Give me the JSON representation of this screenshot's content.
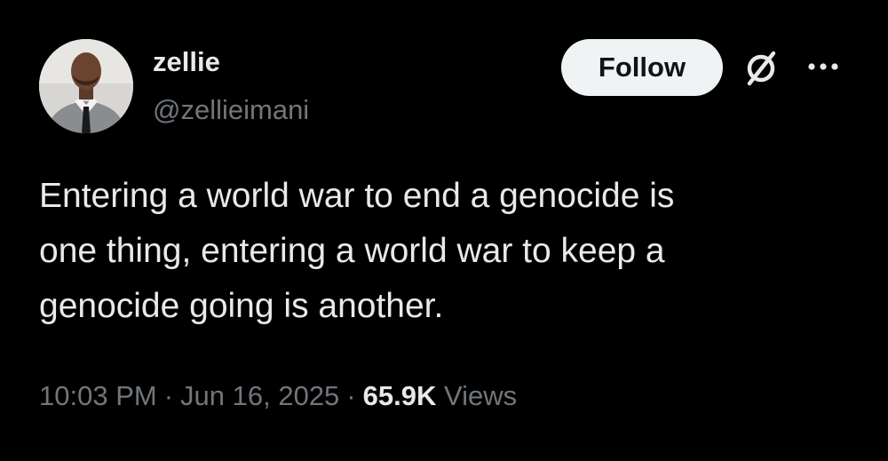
{
  "author": {
    "display_name": "zellie",
    "handle": "@zellieimani",
    "avatar_icon": "profile-photo"
  },
  "actions": {
    "follow_label": "Follow",
    "grok_icon": "grok-icon",
    "more_icon": "more-horizontal-icon"
  },
  "tweet": {
    "text": "Entering a world war to end a genocide is\none thing, entering a world war to keep a\ngenocide going is another."
  },
  "meta": {
    "time": "10:03 PM",
    "separator": "·",
    "date": "Jun 16, 2025",
    "views_count": "65.9K",
    "views_label": "Views"
  },
  "colors": {
    "background": "#000000",
    "primary_text": "#e7e9ea",
    "secondary_text": "#71767b",
    "follow_bg": "#eff3f4",
    "follow_text": "#0f1419"
  }
}
